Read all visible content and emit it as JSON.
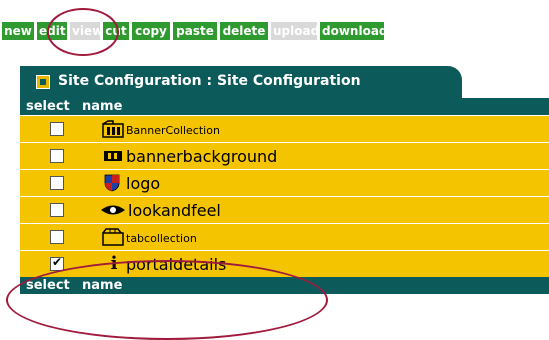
{
  "toolbar": {
    "new": "new",
    "edit": "edit",
    "view": "view",
    "cut": "cut",
    "copy": "copy",
    "paste": "paste",
    "delete": "delete",
    "upload": "upload",
    "download": "download"
  },
  "panel": {
    "title": "Site Configuration : Site Configuration",
    "header_select": "select",
    "header_name": "name"
  },
  "rows": [
    {
      "label": "BannerCollection",
      "icon": "folder-banner-icon",
      "checked": false
    },
    {
      "label": "bannerbackground",
      "icon": "banner-icon",
      "checked": false
    },
    {
      "label": "logo",
      "icon": "shield-icon",
      "checked": false
    },
    {
      "label": "lookandfeel",
      "icon": "eye-icon",
      "checked": false
    },
    {
      "label": "tabcollection",
      "icon": "folder-tab-icon",
      "checked": false
    },
    {
      "label": "portaldetails",
      "icon": "info-icon",
      "checked": true
    }
  ],
  "colors": {
    "toolbar_green": "#2f9a2f",
    "header_teal": "#0d5a5a",
    "row_yellow": "#f5c400",
    "annotation_red": "#a01a3c"
  }
}
